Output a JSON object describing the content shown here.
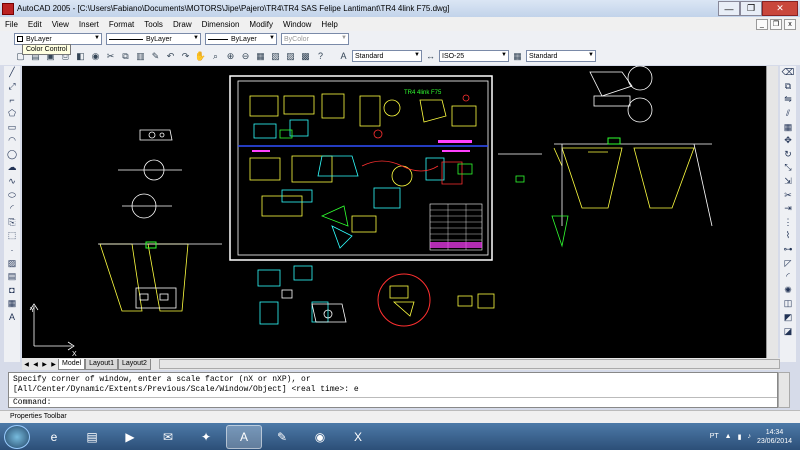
{
  "window": {
    "title": "AutoCAD 2005 - [C:\\Users\\Fabiano\\Documents\\MOTORS\\Jipe\\Pajero\\TR4\\TR4 SAS Felipe Lantimant\\TR4 4link F75.dwg]",
    "minimize": "—",
    "restore": "❐",
    "close": "✕"
  },
  "menu": [
    "File",
    "Edit",
    "View",
    "Insert",
    "Format",
    "Tools",
    "Draw",
    "Dimension",
    "Modify",
    "Window",
    "Help"
  ],
  "properties": {
    "color": "ByLayer",
    "linetype": "ByLayer",
    "lineweight": "ByLayer",
    "plotstyle": "ByColor"
  },
  "styles": {
    "text": "Standard",
    "dim": "ISO-25",
    "table": "Standard"
  },
  "tooltip": "Color Control",
  "tabs": [
    "Model",
    "Layout1",
    "Layout2"
  ],
  "command": {
    "line1": "Specify corner of window, enter a scale factor (nX or nXP), or",
    "line2": "[All/Center/Dynamic/Extents/Previous/Scale/Window/Object] <real time>: e",
    "prompt": "Command:"
  },
  "statusbar": "Properties Toolbar",
  "taskbar": {
    "lang": "PT",
    "time": "14:34",
    "date": "23/06/2014"
  },
  "drawing": {
    "title": "TR4 4link F75",
    "axis_y": "Y",
    "axis_x": "X"
  },
  "colors": {
    "canvas": "#000000",
    "red": "#ff3030",
    "yellow": "#ffff40",
    "green": "#30ff30",
    "cyan": "#30ffff",
    "magenta": "#ff40ff",
    "white": "#ffffff",
    "blue": "#3050ff"
  }
}
